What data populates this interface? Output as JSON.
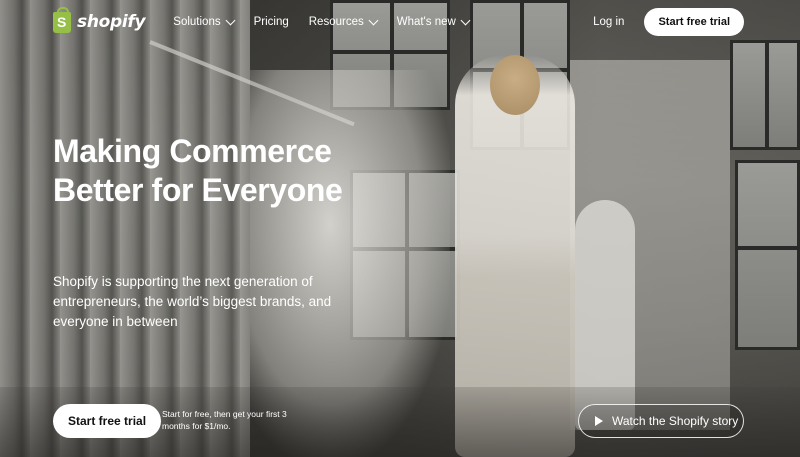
{
  "brand": {
    "name": "shopify",
    "icon": "shopping-bag-icon",
    "icon_color": "#95bf47"
  },
  "nav": {
    "items": [
      {
        "label": "Solutions",
        "has_dropdown": true
      },
      {
        "label": "Pricing",
        "has_dropdown": false
      },
      {
        "label": "Resources",
        "has_dropdown": true
      },
      {
        "label": "What's new",
        "has_dropdown": true
      }
    ],
    "login_label": "Log in",
    "cta_label": "Start free trial"
  },
  "hero": {
    "headline": "Making Commerce Better for Everyone",
    "subheadline": "Shopify is supporting the next generation of entrepreneurs, the world’s biggest brands, and everyone in between",
    "cta_label": "Start free trial",
    "cta_note": "Start for free, then get your first 3 months for $1/mo.",
    "video_label": "Watch the Shopify story",
    "video_icon": "play-icon"
  }
}
